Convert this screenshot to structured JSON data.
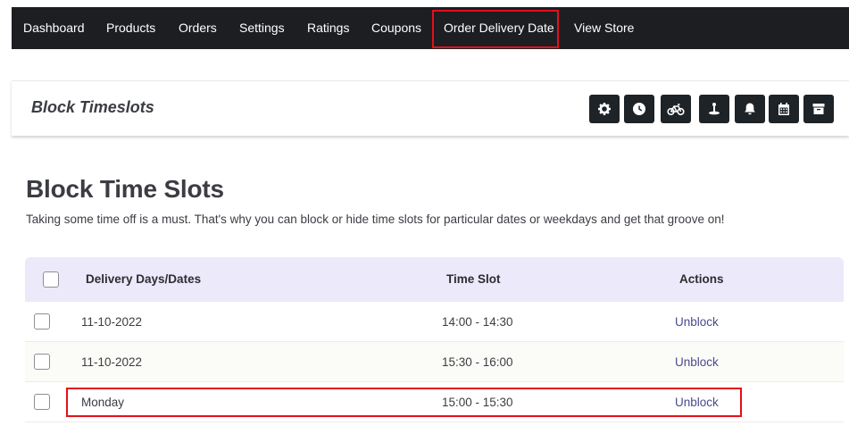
{
  "nav": {
    "items": [
      "Dashboard",
      "Products",
      "Orders",
      "Settings",
      "Ratings",
      "Coupons",
      "Order Delivery Date",
      "View Store"
    ]
  },
  "header": {
    "title": "Block Timeslots",
    "icons": [
      "gear-icon",
      "clock-icon",
      "bicycle-icon",
      "pickup-location-icon",
      "bell-icon",
      "calendar-icon",
      "archive-icon"
    ]
  },
  "main": {
    "title": "Block Time Slots",
    "description": "Taking some time off is a must. That's why you can block or hide time slots for particular dates or weekdays and get that groove on!"
  },
  "table": {
    "columns": [
      "Delivery Days/Dates",
      "Time Slot",
      "Actions"
    ],
    "rows": [
      {
        "date": "11-10-2022",
        "slot": "14:00 - 14:30",
        "action": "Unblock"
      },
      {
        "date": "11-10-2022",
        "slot": "15:30 - 16:00",
        "action": "Unblock"
      },
      {
        "date": "Monday",
        "slot": "15:00 - 15:30",
        "action": "Unblock"
      }
    ]
  },
  "colors": {
    "nav_bg": "#1d1e22",
    "highlight": "#e3101c",
    "table_header_bg": "#ece9fb",
    "link": "#4b4a8c"
  }
}
